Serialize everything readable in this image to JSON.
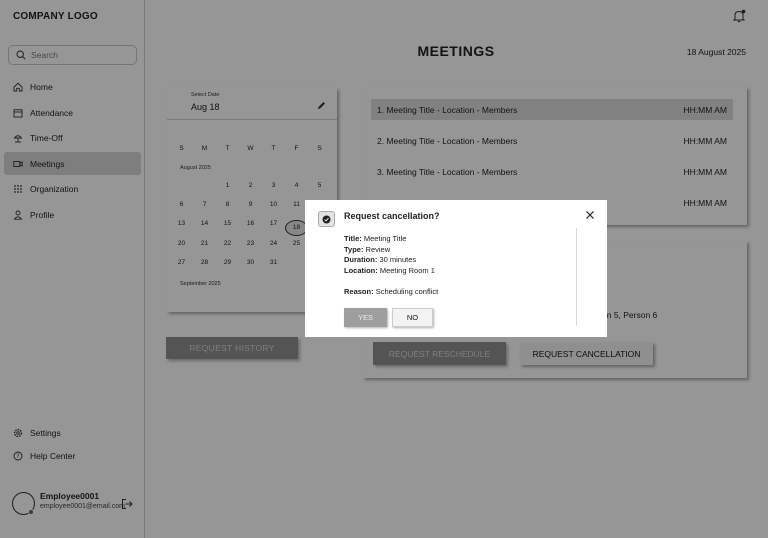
{
  "sidebar": {
    "logo": "COMPANY LOGO",
    "search_placeholder": "Search",
    "items": [
      {
        "label": "Home",
        "icon": "home-icon"
      },
      {
        "label": "Attendance",
        "icon": "calendar-icon"
      },
      {
        "label": "Time-Off",
        "icon": "beach-icon"
      },
      {
        "label": "Meetings",
        "icon": "video-icon",
        "active": true
      },
      {
        "label": "Organization",
        "icon": "grid-icon"
      },
      {
        "label": "Profile",
        "icon": "user-icon"
      }
    ],
    "bottom_items": [
      {
        "label": "Settings",
        "icon": "gear-icon"
      },
      {
        "label": "Help Center",
        "icon": "help-icon"
      }
    ],
    "user": {
      "name": "Employee0001",
      "email": "employee0001@email.com"
    }
  },
  "header": {
    "title": "MEETINGS",
    "date": "18 August 2025"
  },
  "calendar": {
    "label": "Select Date",
    "selected": "Aug 18",
    "weekdays": [
      "S",
      "M",
      "T",
      "W",
      "T",
      "F",
      "S"
    ],
    "month_label": "August 2025",
    "next_month_label": "September 2025",
    "weeks": [
      [
        "",
        "",
        "",
        "",
        "",
        "1",
        "2"
      ],
      [
        "3",
        "4",
        "5",
        "6",
        "7",
        "8",
        "9"
      ],
      [
        "10",
        "11",
        "12",
        "13",
        "14",
        "15",
        "16"
      ],
      [
        "17",
        "18",
        "19",
        "20",
        "21",
        "22",
        "23"
      ],
      [
        "24",
        "25",
        "26",
        "27",
        "28",
        "29",
        "30"
      ]
    ],
    "visible_weeks": [
      [
        "",
        "",
        "1",
        "2",
        "3",
        "4",
        "5"
      ],
      [
        "6",
        "7",
        "8",
        "9",
        "10",
        "11",
        ""
      ],
      [
        "13",
        "14",
        "15",
        "16",
        "17",
        "18",
        ""
      ],
      [
        "20",
        "21",
        "22",
        "23",
        "24",
        "25",
        ""
      ],
      [
        "27",
        "28",
        "29",
        "30",
        "31",
        "",
        ""
      ]
    ],
    "selected_day": "18"
  },
  "history_button": "REQUEST HISTORY",
  "meetings": [
    {
      "title": "1. Meeting Title - Location - Members",
      "time": "HH:MM AM",
      "selected": true
    },
    {
      "title": "2. Meeting Title - Location - Members",
      "time": "HH:MM AM"
    },
    {
      "title": "3. Meeting Title - Location - Members",
      "time": "HH:MM AM"
    },
    {
      "title": "",
      "time": "HH:MM AM"
    }
  ],
  "details": {
    "participants_tail": "on 5, Person 6",
    "reschedule_button": "REQUEST RESCHEDULE",
    "cancel_button": "REQUEST CANCELLATION"
  },
  "modal": {
    "title": "Request cancellation?",
    "fields": [
      {
        "label": "Title:",
        "value": "Meeting Title"
      },
      {
        "label": "Type:",
        "value": "Review"
      },
      {
        "label": "Duration:",
        "value": "30 minutes"
      },
      {
        "label": "Location:",
        "value": "Meeting Room 1"
      }
    ],
    "reason_label": "Reason:",
    "reason_value": "Scheduling conflict",
    "yes": "YES",
    "no": "NO"
  }
}
